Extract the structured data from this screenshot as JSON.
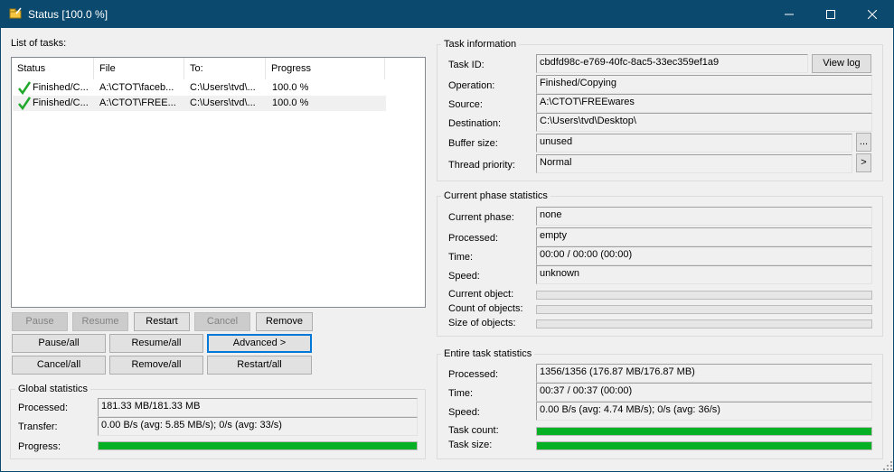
{
  "window": {
    "title": "Status [100.0 %]"
  },
  "task_list": {
    "label": "List of tasks:",
    "columns": [
      "Status",
      "File",
      "To:",
      "Progress"
    ],
    "rows": [
      {
        "status": "Finished/C...",
        "file": "A:\\CTOT\\faceb...",
        "to": "C:\\Users\\tvd\\...",
        "progress": "100.0 %"
      },
      {
        "status": "Finished/C...",
        "file": "A:\\CTOT\\FREE...",
        "to": "C:\\Users\\tvd\\...",
        "progress": "100.0 %"
      }
    ]
  },
  "buttons": {
    "pause": "Pause",
    "resume": "Resume",
    "restart": "Restart",
    "cancel": "Cancel",
    "remove": "Remove",
    "pause_all": "Pause/all",
    "resume_all": "Resume/all",
    "advanced": "Advanced >",
    "cancel_all": "Cancel/all",
    "remove_all": "Remove/all",
    "restart_all": "Restart/all"
  },
  "global_stats": {
    "title": "Global statistics",
    "processed_label": "Processed:",
    "processed_value": "181.33 MB/181.33 MB",
    "transfer_label": "Transfer:",
    "transfer_value": "0.00 B/s (avg: 5.85 MB/s); 0/s (avg: 33/s)",
    "progress_label": "Progress:",
    "progress_fraction": 1.0
  },
  "task_info": {
    "title": "Task information",
    "task_id_label": "Task ID:",
    "task_id_value": "cbdfd98c-e769-40fc-8ac5-33ec359ef1a9",
    "view_log": "View log",
    "operation_label": "Operation:",
    "operation_value": "Finished/Copying",
    "source_label": "Source:",
    "source_value": "A:\\CTOT\\FREEwares",
    "destination_label": "Destination:",
    "destination_value": "C:\\Users\\tvd\\Desktop\\",
    "buffer_label": "Buffer size:",
    "buffer_value": "unused",
    "buffer_button": "...",
    "priority_label": "Thread priority:",
    "priority_value": "Normal",
    "priority_button": ">"
  },
  "phase_stats": {
    "title": "Current phase statistics",
    "phase_label": "Current phase:",
    "phase_value": "none",
    "processed_label": "Processed:",
    "processed_value": "empty",
    "time_label": "Time:",
    "time_value": "00:00 / 00:00 (00:00)",
    "speed_label": "Speed:",
    "speed_value": "unknown",
    "current_object_label": "Current object:",
    "current_object_fraction": 0.0,
    "count_label": "Count of objects:",
    "count_fraction": 0.0,
    "size_label": "Size of objects:",
    "size_fraction": 0.0
  },
  "entire_stats": {
    "title": "Entire task statistics",
    "processed_label": "Processed:",
    "processed_value": "1356/1356 (176.87 MB/176.87 MB)",
    "time_label": "Time:",
    "time_value": "00:37 / 00:37 (00:00)",
    "speed_label": "Speed:",
    "speed_value": "0.00 B/s (avg: 4.74 MB/s); 0/s (avg: 36/s)",
    "task_count_label": "Task count:",
    "task_count_fraction": 1.0,
    "task_size_label": "Task size:",
    "task_size_fraction": 1.0
  },
  "colors": {
    "titlebar": "#0b4a6e",
    "progress": "#06b025",
    "check": "#1fa82b"
  }
}
